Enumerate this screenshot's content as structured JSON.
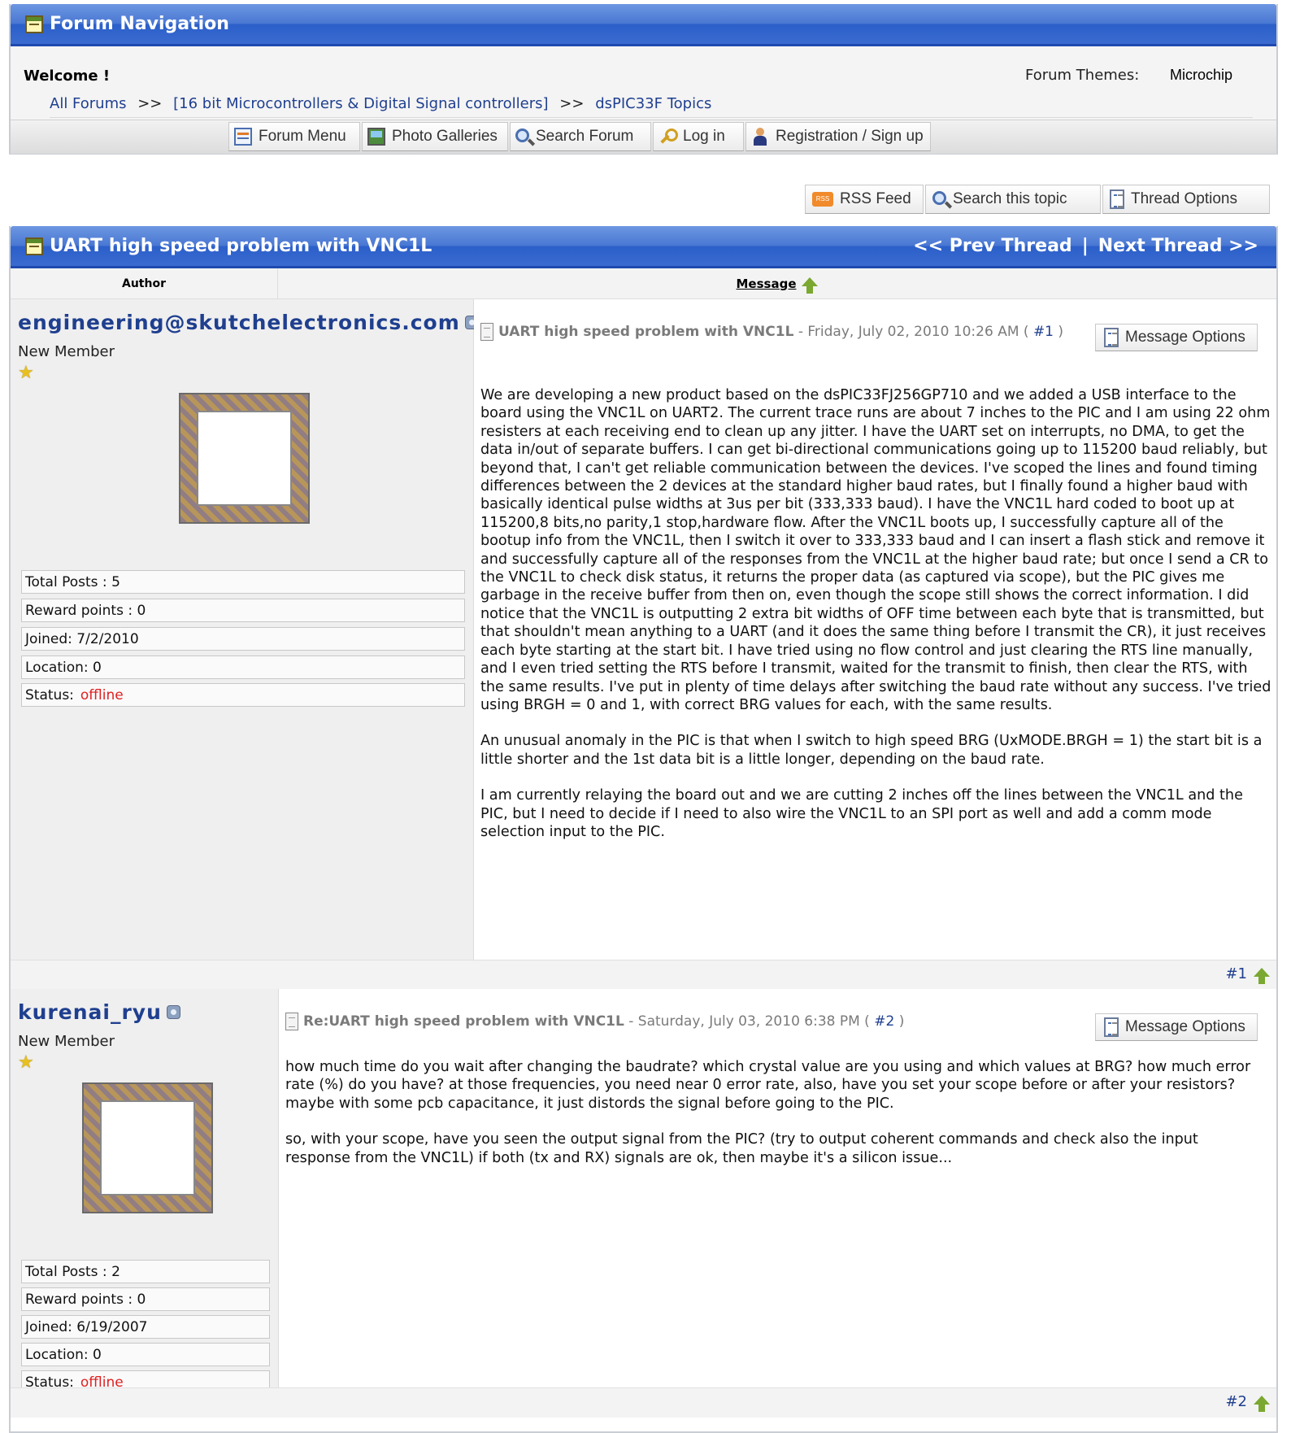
{
  "nav": {
    "title": "Forum Navigation",
    "welcome": "Welcome !",
    "themes_label": "Forum Themes:",
    "themes_value": "Microchip",
    "breadcrumb": {
      "all": "All Forums",
      "sep": ">>",
      "category": "[16 bit Microcontrollers & Digital Signal controllers]",
      "topic": "dsPIC33F Topics"
    },
    "menu": [
      {
        "label": "Forum Menu",
        "icon": "forum-menu-icon"
      },
      {
        "label": "Photo Galleries",
        "icon": "photo-gallery-icon"
      },
      {
        "label": "Search Forum",
        "icon": "search-icon"
      },
      {
        "label": "Log in",
        "icon": "key-icon"
      },
      {
        "label": "Registration / Sign up",
        "icon": "user-icon"
      }
    ]
  },
  "tools": {
    "rss": "RSS Feed",
    "search_topic": "Search this topic",
    "thread_options": "Thread Options"
  },
  "thread": {
    "title": "UART high speed problem with VNC1L",
    "prev": "<< Prev Thread",
    "divider": "|",
    "next": "Next Thread >>",
    "col_author": "Author",
    "col_message": "Message"
  },
  "posts": [
    {
      "author": "engineering@skutchelectronics.com",
      "rank": "New Member",
      "total_posts": "Total Posts : 5",
      "reward": "Reward points : 0",
      "joined": "Joined: 7/2/2010",
      "location": "Location: 0",
      "status_label": "Status:",
      "status_value": "offline",
      "subject": "UART high speed problem with VNC1L",
      "date": " - Friday, July 02, 2010 10:26 AM ( ",
      "num": "#1",
      "close": " )",
      "options": "Message Options",
      "paragraphs": [
        "We are developing a new product based on the dsPIC33FJ256GP710 and we added a USB interface to the board using the VNC1L on UART2.  The current trace runs are about 7 inches to the PIC and I am using 22 ohm resisters at each receiving end to clean up any jitter.  I have the UART set on interrupts, no DMA, to get the data in/out of separate buffers.  I can get bi-directional communications going up to 115200 baud reliably, but beyond that, I can't get reliable communication between the devices.  I've scoped the lines and found timing differences between the 2 devices at the standard higher baud rates, but I finally found a higher baud with basically identical pulse widths at 3us per bit (333,333 baud).  I have the VNC1L hard coded to boot up at 115200,8 bits,no parity,1 stop,hardware flow.  After the VNC1L boots up, I successfully capture all of the bootup info from the VNC1L, then I switch it over to 333,333 baud and I can insert a flash stick and remove it and successfully capture all of the responses from the VNC1L at the higher baud rate; but once I send a CR to the VNC1L to check disk status, it returns the proper data (as captured via scope), but the PIC gives me garbage in the receive buffer from then on, even though the scope still shows the correct information.  I did notice that the VNC1L is outputting 2 extra bit widths of OFF time between each byte that is transmitted, but that shouldn't mean anything to a UART (and it does the same thing before I transmit the CR), it just receives each byte starting at the start bit.  I have tried using no flow control and just clearing the RTS line manually, and I even tried setting the RTS before I transmit, waited for the transmit to finish, then clear the RTS, with the same results.  I've put in plenty of time delays after switching the baud rate without any success.  I've tried using BRGH = 0 and 1, with correct BRG values for each, with the same results.",
        "An unusual anomaly in the PIC is that when I switch to high speed BRG (UxMODE.BRGH = 1) the start bit is a little shorter and the 1st data bit is a little longer, depending on the baud rate.",
        "I am currently relaying the board out and we are cutting 2 inches off the lines between the VNC1L and the PIC, but I need to decide if I need to also wire the VNC1L to an SPI port as well and add a comm mode selection input to the PIC."
      ],
      "foot": "#1"
    },
    {
      "author": "kurenai_ryu",
      "rank": "New Member",
      "total_posts": "Total Posts : 2",
      "reward": "Reward points : 0",
      "joined": "Joined: 6/19/2007",
      "location": "Location: 0",
      "status_label": "Status:",
      "status_value": "offline",
      "subject": "Re:UART high speed problem with VNC1L",
      "date": " - Saturday, July 03, 2010 6:38 PM ( ",
      "num": "#2",
      "close": " )",
      "options": "Message Options",
      "paragraphs": [
        "how much time do you wait after changing the baudrate? which crystal value are you using and which values at BRG? how much error rate (%) do you have? at those frequencies, you need  near 0 error rate, also, have you set your scope before or after your resistors? maybe with some pcb capacitance, it just distords the signal before going to the PIC.",
        "so, with your scope, have you seen the output signal from the PIC? (try to output coherent commands and check also the input response from the VNC1L) if both (tx and RX) signals are ok, then maybe it's a silicon issue..."
      ],
      "foot": "#2"
    }
  ]
}
